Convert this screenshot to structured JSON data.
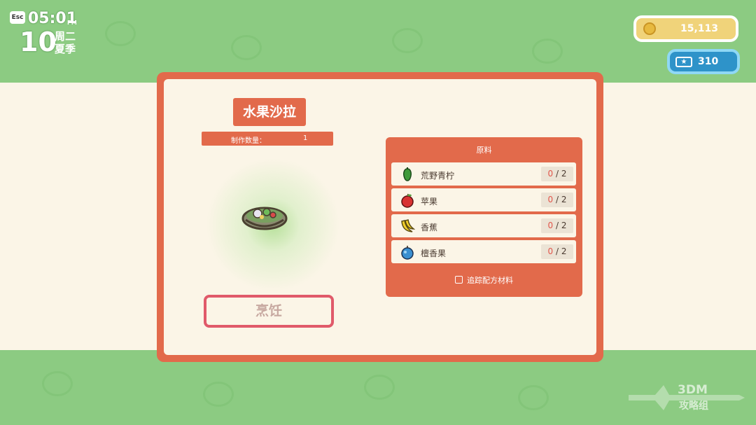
{
  "hud": {
    "esc_label": "Esc",
    "time": "05:01",
    "ampm": "PM",
    "day": "10",
    "weekday": "周二",
    "season": "夏季",
    "coins": "15,113",
    "tickets": "310"
  },
  "recipe": {
    "title": "水果沙拉",
    "quantity_label": "制作数量：",
    "quantity": "1",
    "dish_icon": "fruit-salad-bowl",
    "cook_button": "烹饪"
  },
  "ingredients": {
    "header": "原料",
    "items": [
      {
        "name": "荒野青柠",
        "icon": "green-lime",
        "have": "0",
        "sep": " / ",
        "need": "2"
      },
      {
        "name": "苹果",
        "icon": "red-apple",
        "have": "0",
        "sep": " / ",
        "need": "2"
      },
      {
        "name": "香蕉",
        "icon": "banana",
        "have": "0",
        "sep": " / ",
        "need": "2"
      },
      {
        "name": "檀香果",
        "icon": "blue-fruit",
        "have": "0",
        "sep": " / ",
        "need": "2"
      }
    ],
    "track_label": "追踪配方材料"
  },
  "watermark": {
    "line1": "3DM",
    "line2": "攻略组"
  },
  "colors": {
    "panel": "#e26a4b",
    "cream": "#fbf5e7",
    "background": "#8ccb82",
    "coin": "#f0d37a",
    "ticket": "#2e93c9"
  }
}
